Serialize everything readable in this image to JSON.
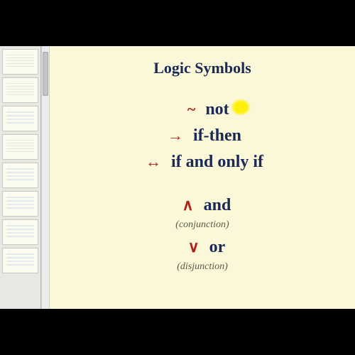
{
  "title": "Logic Symbols",
  "rows": [
    {
      "symbol": "~",
      "label": "not",
      "highlight": true
    },
    {
      "symbol": "→",
      "label": "if-then"
    },
    {
      "symbol": "↔",
      "label": "if and only if"
    }
  ],
  "rows2": [
    {
      "symbol": "∧",
      "label": "and",
      "sub": "(conjunction)"
    },
    {
      "symbol": "∨",
      "label": "or",
      "sub": "(disjunction)"
    }
  ],
  "sidebar_thumb_count": 8
}
